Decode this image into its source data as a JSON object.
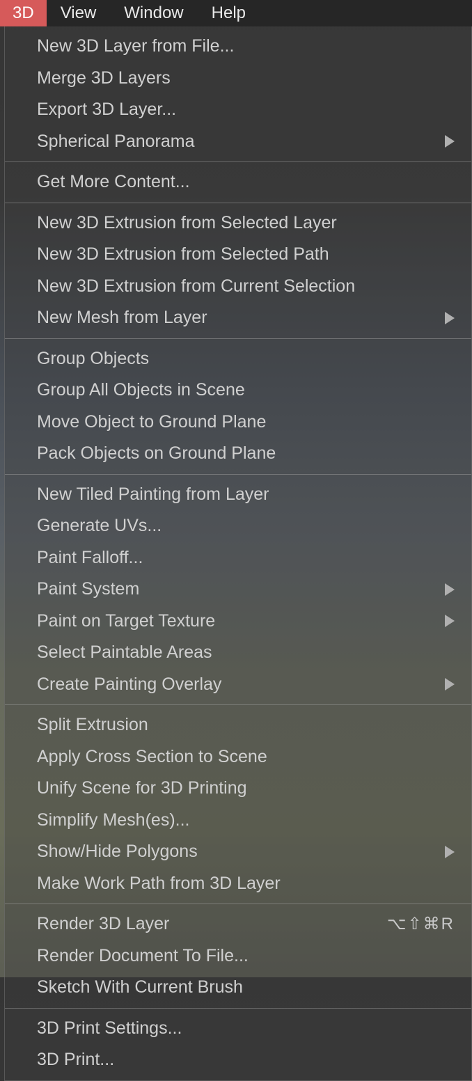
{
  "menubar": {
    "items": [
      {
        "label": "3D",
        "active": true
      },
      {
        "label": "View",
        "active": false
      },
      {
        "label": "Window",
        "active": false
      },
      {
        "label": "Help",
        "active": false
      }
    ]
  },
  "menu": {
    "sections": [
      {
        "items": [
          {
            "label": "New 3D Layer from File...",
            "submenu": false
          },
          {
            "label": "Merge 3D Layers",
            "submenu": false
          },
          {
            "label": "Export 3D Layer...",
            "submenu": false
          },
          {
            "label": "Spherical Panorama",
            "submenu": true
          }
        ]
      },
      {
        "items": [
          {
            "label": "Get More Content...",
            "submenu": false
          }
        ]
      },
      {
        "items": [
          {
            "label": "New 3D Extrusion from Selected Layer",
            "submenu": false
          },
          {
            "label": "New 3D Extrusion from Selected Path",
            "submenu": false
          },
          {
            "label": "New 3D Extrusion from Current Selection",
            "submenu": false
          },
          {
            "label": "New Mesh from Layer",
            "submenu": true
          }
        ]
      },
      {
        "items": [
          {
            "label": "Group Objects",
            "submenu": false
          },
          {
            "label": "Group All Objects in Scene",
            "submenu": false
          },
          {
            "label": "Move Object to Ground Plane",
            "submenu": false
          },
          {
            "label": "Pack Objects on Ground Plane",
            "submenu": false
          }
        ]
      },
      {
        "items": [
          {
            "label": "New Tiled Painting from Layer",
            "submenu": false
          },
          {
            "label": "Generate UVs...",
            "submenu": false
          },
          {
            "label": "Paint Falloff...",
            "submenu": false
          },
          {
            "label": "Paint System",
            "submenu": true
          },
          {
            "label": "Paint on Target Texture",
            "submenu": true
          },
          {
            "label": "Select Paintable Areas",
            "submenu": false
          },
          {
            "label": "Create Painting Overlay",
            "submenu": true
          }
        ]
      },
      {
        "items": [
          {
            "label": "Split Extrusion",
            "submenu": false
          },
          {
            "label": "Apply Cross Section to Scene",
            "submenu": false
          },
          {
            "label": "Unify Scene for 3D Printing",
            "submenu": false
          },
          {
            "label": "Simplify Mesh(es)...",
            "submenu": false
          },
          {
            "label": "Show/Hide Polygons",
            "submenu": true
          },
          {
            "label": "Make Work Path from 3D Layer",
            "submenu": false
          }
        ]
      },
      {
        "items": [
          {
            "label": "Render 3D Layer",
            "submenu": false,
            "shortcut": "⌥⇧⌘R"
          },
          {
            "label": "Render Document To File...",
            "submenu": false
          },
          {
            "label": "Sketch With Current Brush",
            "submenu": false
          }
        ]
      },
      {
        "items": [
          {
            "label": "3D Print Settings...",
            "submenu": false
          },
          {
            "label": "3D Print...",
            "submenu": false
          }
        ]
      }
    ]
  }
}
